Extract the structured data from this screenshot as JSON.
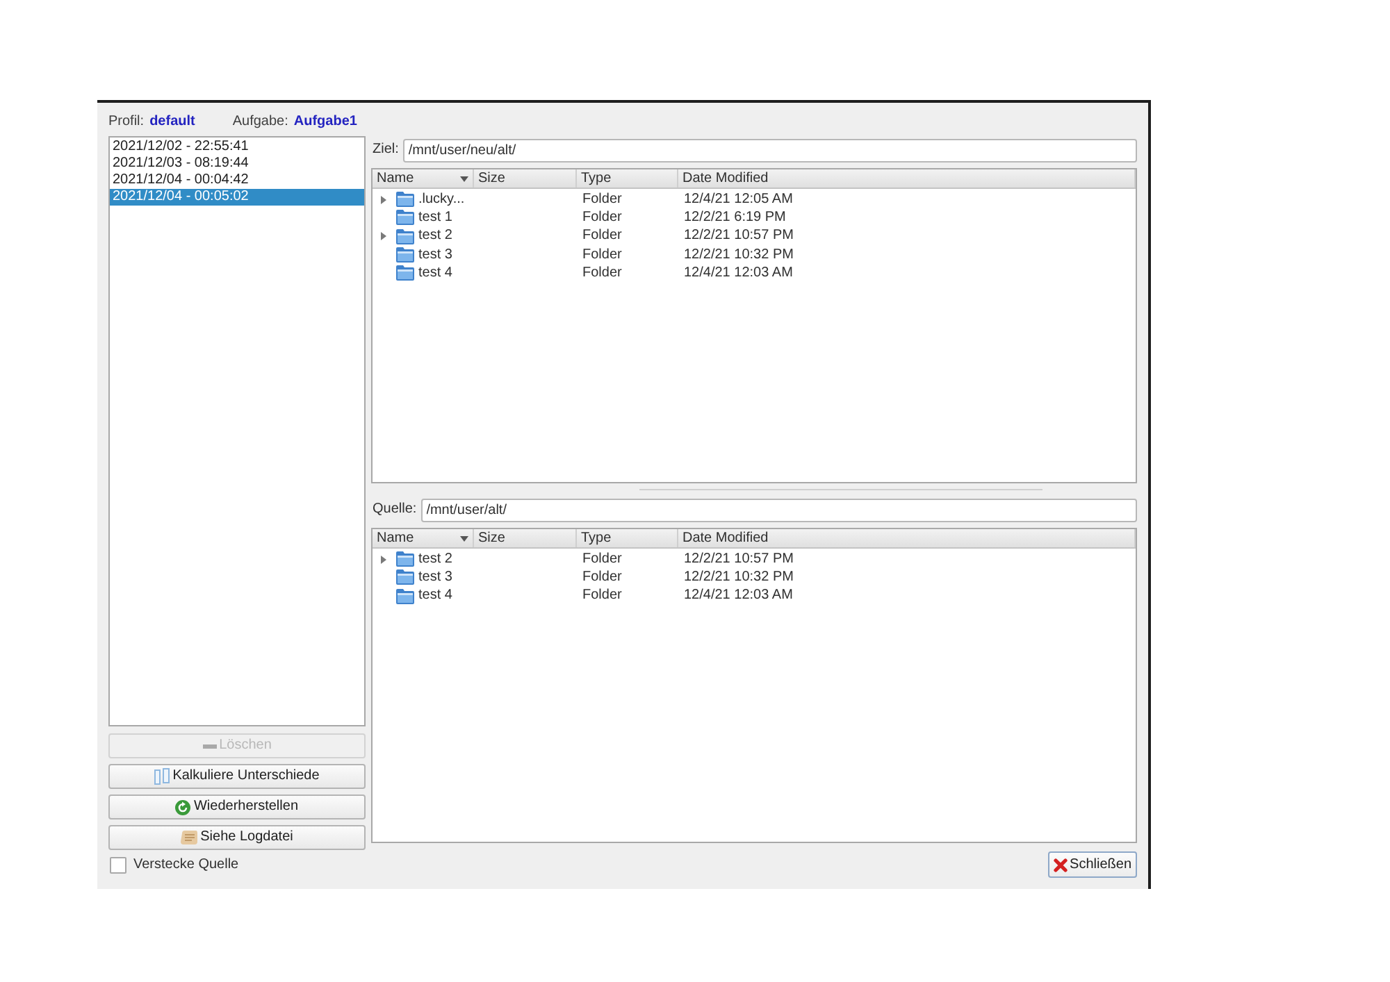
{
  "header": {
    "profile_label": "Profil:",
    "profile": "default",
    "task_label": "Aufgabe:",
    "task": "Aufgabe1"
  },
  "snapshots": [
    {
      "label": "2021/12/02 - 22:55:41",
      "selected": false
    },
    {
      "label": "2021/12/03 - 08:19:44",
      "selected": false
    },
    {
      "label": "2021/12/04 - 00:04:42",
      "selected": false
    },
    {
      "label": "2021/12/04 - 00:05:02",
      "selected": true
    }
  ],
  "actions": [
    {
      "kind": "delete",
      "label": "Löschen",
      "disabled": true
    },
    {
      "kind": "compare",
      "label": "Kalkuliere Unterschiede",
      "disabled": false
    },
    {
      "kind": "restore",
      "label": "Wiederherstellen",
      "disabled": false
    },
    {
      "kind": "log",
      "label": "Siehe Logdatei",
      "disabled": false
    }
  ],
  "hide_source": {
    "label": "Verstecke Quelle",
    "checked": false
  },
  "panes": [
    {
      "label": "Ziel:",
      "path": "/mnt/user/neu/alt/",
      "columns": [
        {
          "label": "Name",
          "sorted": true
        },
        {
          "label": "Size",
          "sorted": false
        },
        {
          "label": "Type",
          "sorted": false
        },
        {
          "label": "Date Modified",
          "sorted": false
        }
      ],
      "rows": [
        {
          "name": ".lucky...",
          "type": "Folder",
          "date_modified": "12/4/21 12:05 AM",
          "expandable": true
        },
        {
          "name": "test 1",
          "type": "Folder",
          "date_modified": "12/2/21 6:19 PM",
          "expandable": false
        },
        {
          "name": "test 2",
          "type": "Folder",
          "date_modified": "12/2/21 10:57 PM",
          "expandable": true
        },
        {
          "name": "test 3",
          "type": "Folder",
          "date_modified": "12/2/21 10:32 PM",
          "expandable": false
        },
        {
          "name": "test 4",
          "type": "Folder",
          "date_modified": "12/4/21 12:03 AM",
          "expandable": false
        }
      ]
    },
    {
      "label": "Quelle:",
      "path": "/mnt/user/alt/",
      "columns": [
        {
          "label": "Name",
          "sorted": true
        },
        {
          "label": "Size",
          "sorted": false
        },
        {
          "label": "Type",
          "sorted": false
        },
        {
          "label": "Date Modified",
          "sorted": false
        }
      ],
      "rows": [
        {
          "name": "test 2",
          "type": "Folder",
          "date_modified": "12/2/21 10:57 PM",
          "expandable": true
        },
        {
          "name": "test 3",
          "type": "Folder",
          "date_modified": "12/2/21 10:32 PM",
          "expandable": false
        },
        {
          "name": "test 4",
          "type": "Folder",
          "date_modified": "12/4/21 12:03 AM",
          "expandable": false
        }
      ]
    }
  ],
  "close_button": {
    "label": "Schließen"
  }
}
